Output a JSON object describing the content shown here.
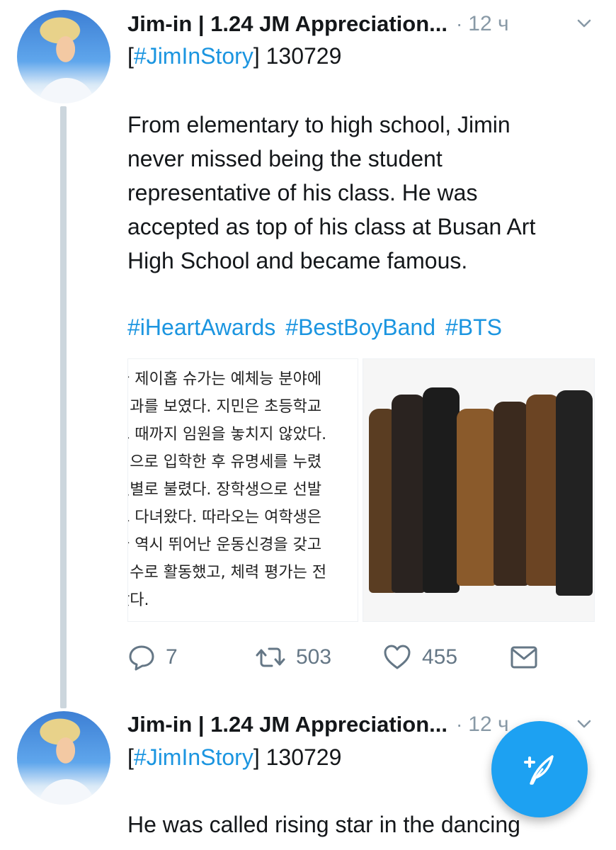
{
  "tweets": [
    {
      "name": "Jim-in | 1.24 JM Appreciation...",
      "time": "12 ч",
      "hashtag_open": "[",
      "hashtag_link": "#JimInStory",
      "hashtag_rest": "] 130729",
      "body": "From elementary to high school, Jimin\nnever missed being the student\nrepresentative of his class. He was\naccepted as top of his class at Busan Art\nHigh School and became famous.",
      "hashtags": [
        "#iHeartAwards",
        "#BestBoyBand",
        "#BTS"
      ],
      "media_text_lines": [
        "국 제이홉 슈가는 예체능 분야에",
        " 성과를 보였다. 지민은 초등학교",
        "교 때까지 임원을 놓치지 않았다.",
        "석으로 입학한 후 유명세를 누렸",
        " 샛별로 불렸다. 장학생으로 선발",
        "도 다녀왔다. 따라오는 여학생은",
        "국 역시 뛰어난 운동신경을 갖고",
        " 선수로 활동했고, 체력 평가는 전",
        "랐다."
      ],
      "replies": "7",
      "retweets": "503",
      "likes": "455"
    },
    {
      "name": "Jim-in | 1.24 JM Appreciation...",
      "time": "12 ч",
      "hashtag_open": "[",
      "hashtag_link": "#JimInStory",
      "hashtag_rest": "] 130729",
      "body": "He was called rising star in the dancing"
    }
  ],
  "icons": {
    "reply": "reply-icon",
    "retweet": "retweet-icon",
    "like": "heart-icon",
    "share": "envelope-icon",
    "menu": "chevron-down-icon",
    "compose": "compose-feather-icon"
  },
  "colors": {
    "link": "#1b95e0",
    "fab": "#1da1f2",
    "muted": "#657786",
    "thread": "#ccd6dd"
  }
}
